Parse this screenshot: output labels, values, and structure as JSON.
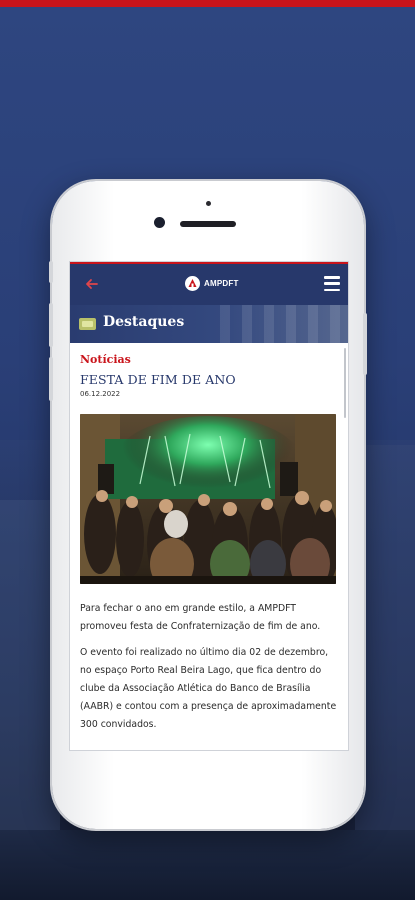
{
  "header": {
    "logo_text": "AMPDFT"
  },
  "section": {
    "title": "Destaques"
  },
  "article": {
    "category": "Notícias",
    "title": "FESTA DE FIM DE ANO",
    "date": "06.12.2022",
    "paragraphs": [
      "Para fechar o ano em grande estilo, a AMPDFT promoveu festa de Confraternização de fim de ano.",
      "O evento foi realizado no último dia 02 de dezembro, no espaço Porto Real Beira Lago, que fica dentro do clube da Associação Atlética do Banco de Brasília (AABR) e contou com a presença de aproximadamente 300 convidados."
    ]
  },
  "icons": {
    "back": "arrow-left-icon",
    "menu": "hamburger-menu-icon",
    "section": "newspaper-icon",
    "logo": "ampdft-logo"
  },
  "colors": {
    "accent_red": "#c9141b",
    "navy": "#27386b",
    "background_blue": "#2e4680"
  }
}
